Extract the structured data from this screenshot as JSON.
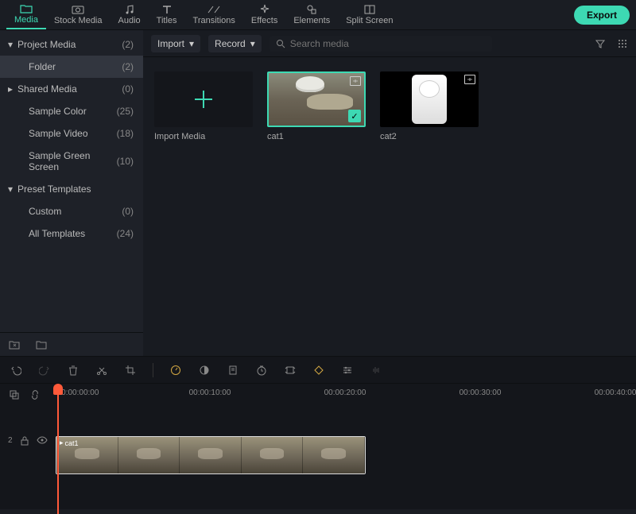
{
  "topbar": {
    "tabs": [
      {
        "label": "Media",
        "icon": "folder"
      },
      {
        "label": "Stock Media",
        "icon": "camera"
      },
      {
        "label": "Audio",
        "icon": "music"
      },
      {
        "label": "Titles",
        "icon": "text"
      },
      {
        "label": "Transitions",
        "icon": "transition"
      },
      {
        "label": "Effects",
        "icon": "sparkle"
      },
      {
        "label": "Elements",
        "icon": "shapes"
      },
      {
        "label": "Split Screen",
        "icon": "split"
      }
    ],
    "export": "Export"
  },
  "sidebar": {
    "groups": [
      {
        "label": "Project Media",
        "count": "(2)",
        "expanded": true,
        "children": [
          {
            "label": "Folder",
            "count": "(2)",
            "selected": true
          }
        ]
      },
      {
        "label": "Shared Media",
        "count": "(0)",
        "expanded": false,
        "children": [
          {
            "label": "Sample Color",
            "count": "(25)"
          },
          {
            "label": "Sample Video",
            "count": "(18)"
          },
          {
            "label": "Sample Green Screen",
            "count": "(10)"
          }
        ]
      },
      {
        "label": "Preset Templates",
        "count": "",
        "expanded": true,
        "children": [
          {
            "label": "Custom",
            "count": "(0)"
          },
          {
            "label": "All Templates",
            "count": "(24)"
          }
        ]
      }
    ]
  },
  "toolbar": {
    "import": "Import",
    "record": "Record",
    "search_placeholder": "Search media"
  },
  "media": {
    "items": [
      {
        "label": "Import Media",
        "type": "import"
      },
      {
        "label": "cat1",
        "type": "video",
        "selected": true
      },
      {
        "label": "cat2",
        "type": "video",
        "selected": false
      }
    ]
  },
  "timeline": {
    "ruler": [
      "00:00:00:00",
      "00:00:10:00",
      "00:00:20:00",
      "00:00:30:00",
      "00:00:40:00"
    ],
    "track_label": "2",
    "clip": {
      "name": "cat1"
    }
  }
}
